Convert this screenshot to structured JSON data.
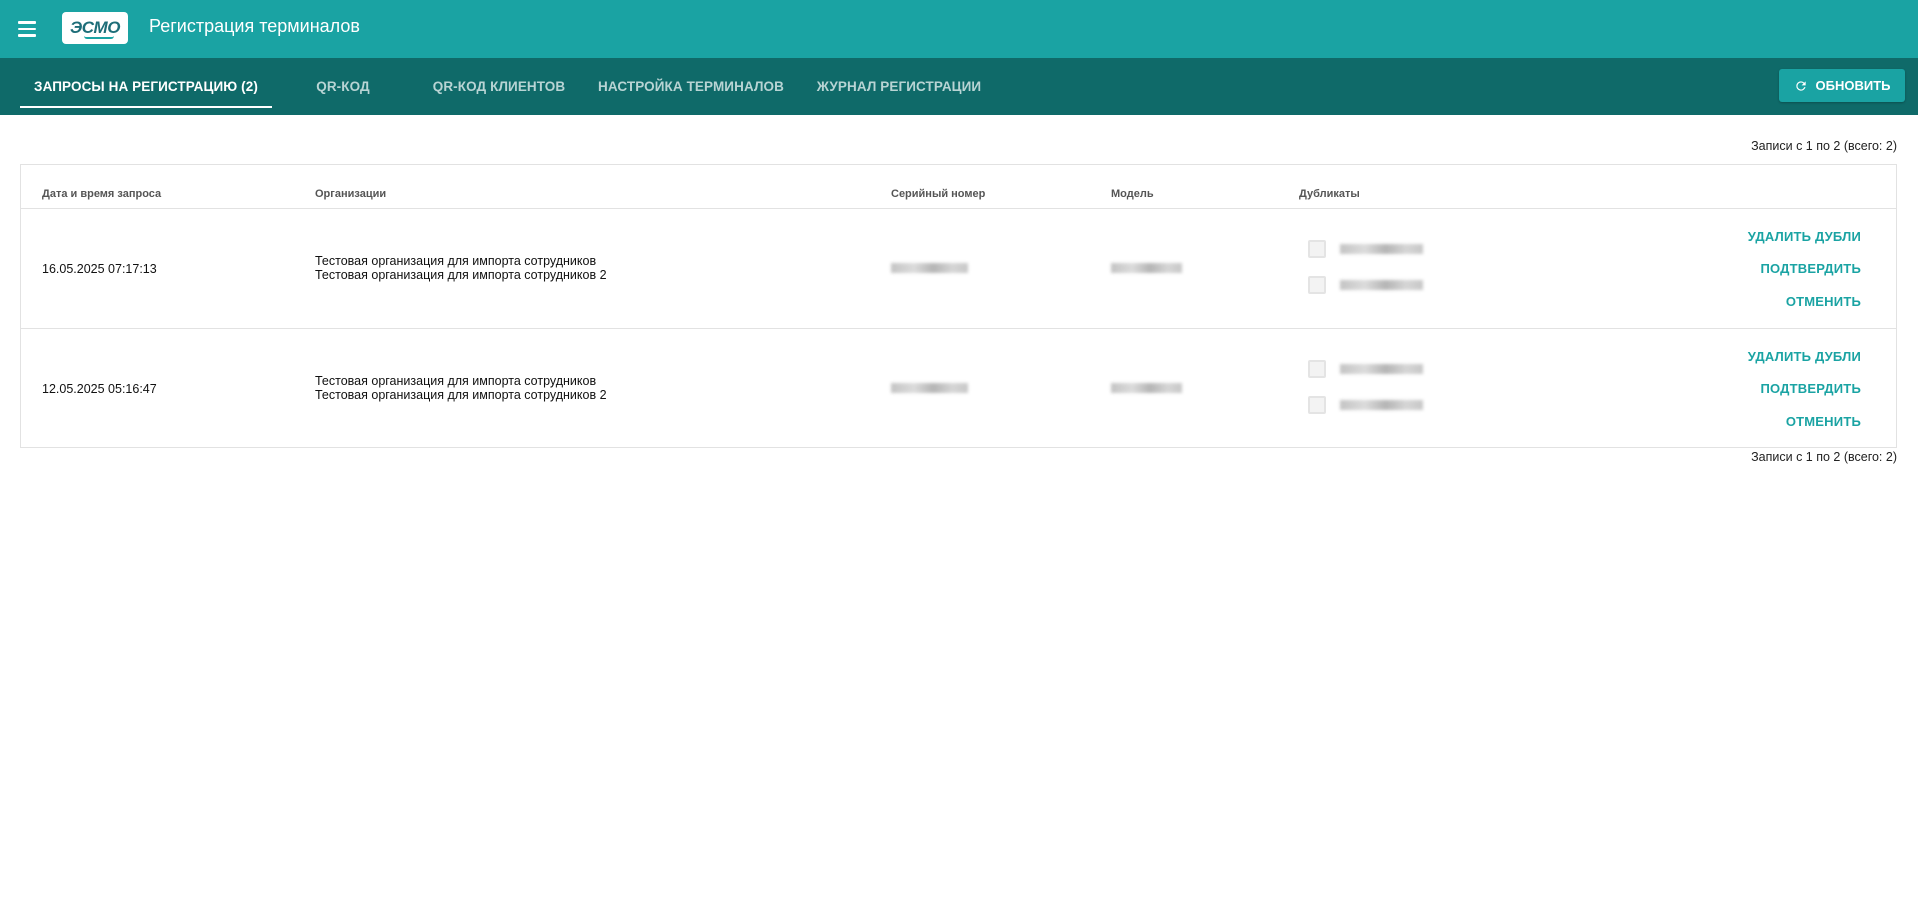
{
  "header": {
    "logo_text": "ЭСМО",
    "title": "Регистрация терминалов"
  },
  "tabs": [
    {
      "label": "ЗАПРОСЫ НА РЕГИСТРАЦИЮ (2)",
      "active": true
    },
    {
      "label": "QR-КОД",
      "active": false
    },
    {
      "label": "QR-КОД КЛИЕНТОВ",
      "active": false
    },
    {
      "label": "НАСТРОЙКА ТЕРМИНАЛОВ",
      "active": false
    },
    {
      "label": "ЖУРНАЛ РЕГИСТРАЦИИ",
      "active": false
    }
  ],
  "toolbar": {
    "refresh_label": "ОБНОВИТЬ",
    "refresh_icon": "refresh-icon"
  },
  "pagination": {
    "records_text": "Записи с 1 по 2 (всего: 2)"
  },
  "table": {
    "columns": [
      "Дата и время запроса",
      "Организации",
      "Серийный номер",
      "Модель",
      "Дубликаты"
    ],
    "rows": [
      {
        "datetime": "16.05.2025 07:17:13",
        "organizations": [
          "Тестовая организация для импорта сотрудников",
          "Тестовая организация для импорта сотрудников 2"
        ],
        "actions": {
          "delete": "УДАЛИТЬ ДУБЛИ",
          "confirm": "ПОДТВЕРДИТЬ",
          "cancel": "ОТМЕНИТЬ"
        }
      },
      {
        "datetime": "12.05.2025 05:16:47",
        "organizations": [
          "Тестовая организация для импорта сотрудников",
          "Тестовая организация для импорта сотрудников 2"
        ],
        "actions": {
          "delete": "УДАЛИТЬ ДУБЛИ",
          "confirm": "ПОДТВЕРДИТЬ",
          "cancel": "ОТМЕНИТЬ"
        }
      }
    ]
  },
  "colors": {
    "primary": "#1aa3a3",
    "tab_bar": "#0f6a69",
    "tab_inactive": "#b8d4d4"
  }
}
